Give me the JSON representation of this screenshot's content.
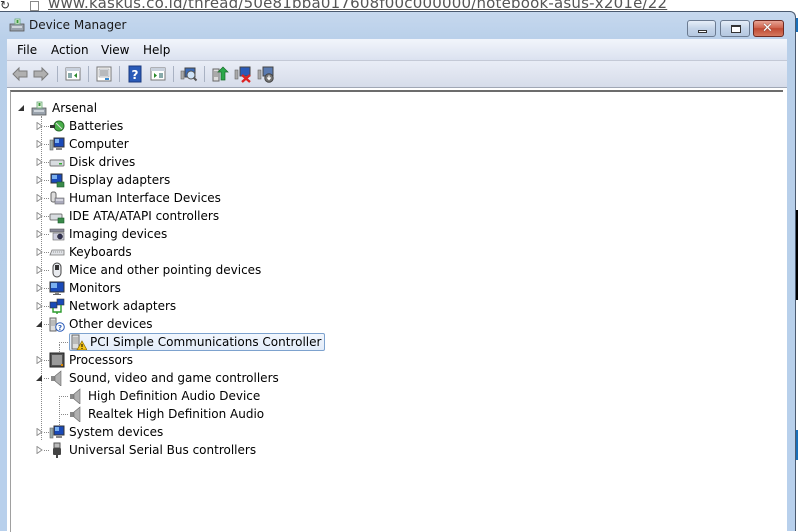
{
  "background": {
    "url_text": "www.kaskus.co.id/thread/50e81bba017608f00c000000/notebook-asus-x201e/22"
  },
  "window": {
    "title": "Device Manager",
    "controls": {
      "minimize": "minimize",
      "maximize": "maximize",
      "close": "close"
    }
  },
  "menubar": {
    "items": [
      {
        "label": "File"
      },
      {
        "label": "Action"
      },
      {
        "label": "View"
      },
      {
        "label": "Help"
      }
    ]
  },
  "toolbar": {
    "buttons": [
      {
        "icon": "back-arrow-icon",
        "tooltip": "Back"
      },
      {
        "icon": "forward-arrow-icon",
        "tooltip": "Forward"
      },
      {
        "icon": "show-hide-console-tree-icon",
        "tooltip": "Show/Hide Console Tree"
      },
      {
        "icon": "properties-icon",
        "tooltip": "Properties"
      },
      {
        "icon": "help-icon",
        "tooltip": "Help"
      },
      {
        "icon": "show-hide-action-pane-icon",
        "tooltip": "Show/Hide Action Pane"
      },
      {
        "icon": "scan-hardware-changes-icon",
        "tooltip": "Scan for hardware changes"
      },
      {
        "icon": "update-driver-icon",
        "tooltip": "Update Driver Software"
      },
      {
        "icon": "uninstall-icon",
        "tooltip": "Uninstall"
      },
      {
        "icon": "disable-icon",
        "tooltip": "Disable"
      }
    ]
  },
  "tree": {
    "root": {
      "label": "Arsenal",
      "expanded": true,
      "icon": "computer-root-icon"
    },
    "categories": [
      {
        "label": "Batteries",
        "expanded": false,
        "icon": "battery-icon"
      },
      {
        "label": "Computer",
        "expanded": false,
        "icon": "computer-icon"
      },
      {
        "label": "Disk drives",
        "expanded": false,
        "icon": "disk-drive-icon"
      },
      {
        "label": "Display adapters",
        "expanded": false,
        "icon": "display-adapter-icon"
      },
      {
        "label": "Human Interface Devices",
        "expanded": false,
        "icon": "hid-icon"
      },
      {
        "label": "IDE ATA/ATAPI controllers",
        "expanded": false,
        "icon": "ide-controller-icon"
      },
      {
        "label": "Imaging devices",
        "expanded": false,
        "icon": "imaging-device-icon"
      },
      {
        "label": "Keyboards",
        "expanded": false,
        "icon": "keyboard-icon"
      },
      {
        "label": "Mice and other pointing devices",
        "expanded": false,
        "icon": "mouse-icon"
      },
      {
        "label": "Monitors",
        "expanded": false,
        "icon": "monitor-icon"
      },
      {
        "label": "Network adapters",
        "expanded": false,
        "icon": "network-adapter-icon"
      },
      {
        "label": "Other devices",
        "expanded": true,
        "icon": "unknown-device-icon",
        "children": [
          {
            "label": "PCI Simple Communications Controller",
            "icon": "warning-device-icon",
            "selected": true
          }
        ]
      },
      {
        "label": "Processors",
        "expanded": false,
        "icon": "processor-icon"
      },
      {
        "label": "Sound, video and game controllers",
        "expanded": true,
        "icon": "speaker-icon",
        "children": [
          {
            "label": "High Definition Audio Device",
            "icon": "speaker-icon"
          },
          {
            "label": "Realtek High Definition Audio",
            "icon": "speaker-icon"
          }
        ]
      },
      {
        "label": "System devices",
        "expanded": false,
        "icon": "system-device-icon"
      },
      {
        "label": "Universal Serial Bus controllers",
        "expanded": false,
        "icon": "usb-icon"
      }
    ]
  }
}
